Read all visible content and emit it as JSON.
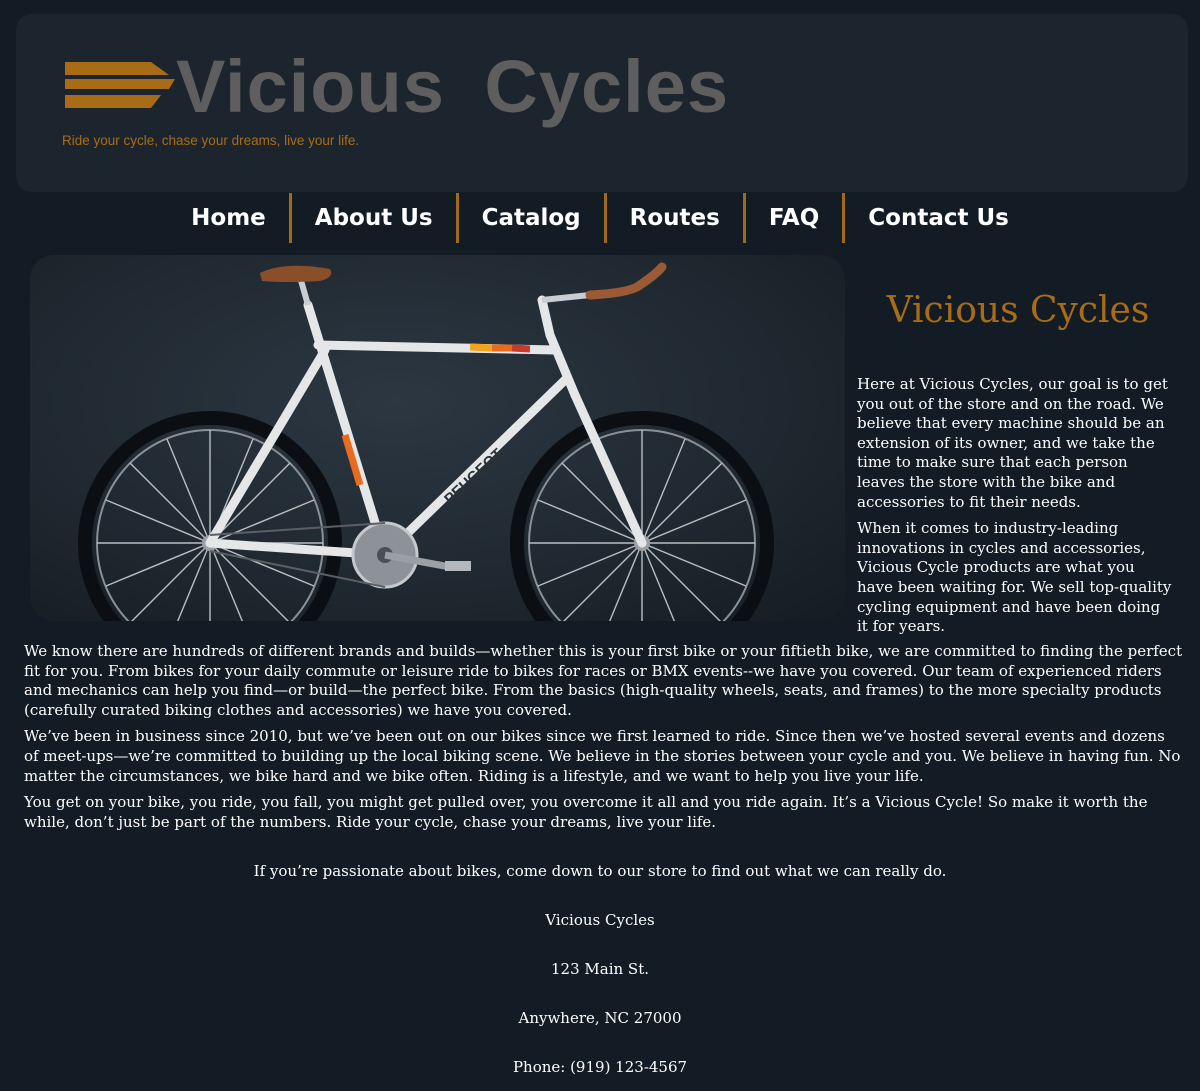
{
  "header": {
    "logo_text": "Vicious Cycles",
    "tagline": "Ride your cycle, chase your dreams, live your life."
  },
  "nav": {
    "items": [
      {
        "label": "Home"
      },
      {
        "label": "About Us"
      },
      {
        "label": "Catalog"
      },
      {
        "label": "Routes"
      },
      {
        "label": "FAQ"
      },
      {
        "label": "Contact Us"
      }
    ]
  },
  "hero": {
    "frame_brand": "PEUGEOT"
  },
  "intro": {
    "title": "Vicious Cycles",
    "paragraphs": [
      "Here at Vicious Cycles, our goal is to get you out of the store and on the road. We believe that every machine should be an extension of its owner, and we take the time to make sure that each person leaves the store with the bike and accessories to fit their needs.",
      "When it comes to industry-leading innovations in cycles and accessories, Vicious Cycle products are what you have been waiting for. We sell top-quality cycling equipment and have been doing it for years."
    ]
  },
  "main": {
    "paragraphs": [
      "We know there are hundreds of different brands and builds—whether this is your first bike or your fiftieth bike, we are committed to finding the perfect fit for you. From bikes for your daily commute or leisure ride to bikes for races or BMX events--we have you covered. Our team of experienced riders and mechanics can help you find—or build—the perfect bike. From the basics (high-quality wheels, seats, and frames) to the more specialty products (carefully curated biking clothes and accessories) we have you covered.",
      "We’ve been in business since 2010, but we’ve been out on our bikes since we first learned to ride. Since then we’ve hosted several events and dozens of meet-ups—we’re committed to building up the local biking scene. We believe in the stories between your cycle and you. We believe in having fun. No matter the circumstances, we bike hard and we bike often. Riding is a lifestyle, and we want to help you live your life.",
      "You get on your bike, you ride, you fall, you might get pulled over, you overcome it all and you ride again. It’s a Vicious Cycle! So make it worth the while, don’t just be part of the numbers. Ride your cycle, chase your dreams, live your life."
    ]
  },
  "contact": {
    "invite": "If you’re passionate about bikes, come down to our store to find out what we can really do.",
    "name": "Vicious Cycles",
    "street": "123 Main St.",
    "city": "Anywhere, NC 27000",
    "phone": "Phone: (919) 123-4567"
  },
  "colors": {
    "background": "#131c25",
    "header_panel": "#1c252e",
    "accent": "#a86c17",
    "logo_gray": "#5e5e5e",
    "text": "#ffffff"
  }
}
